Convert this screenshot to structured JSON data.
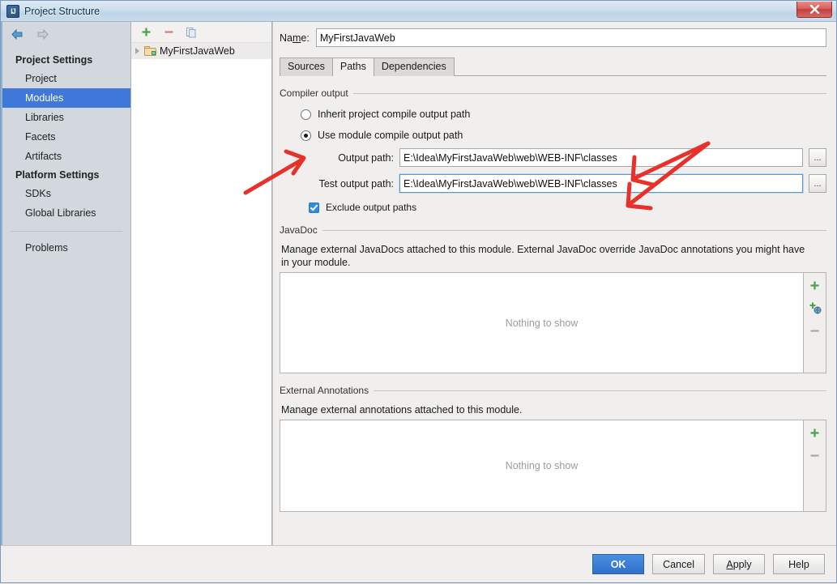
{
  "window": {
    "title": "Project Structure",
    "app_icon": "intellij-idea-icon",
    "close_label": "x"
  },
  "nav": {
    "back_icon": "arrow-left-icon",
    "forward_icon": "arrow-right-icon"
  },
  "sidebar": {
    "groups": [
      {
        "title": "Project Settings",
        "items": [
          {
            "label": "Project",
            "selected": false
          },
          {
            "label": "Modules",
            "selected": true
          },
          {
            "label": "Libraries",
            "selected": false
          },
          {
            "label": "Facets",
            "selected": false
          },
          {
            "label": "Artifacts",
            "selected": false
          }
        ]
      },
      {
        "title": "Platform Settings",
        "items": [
          {
            "label": "SDKs",
            "selected": false
          },
          {
            "label": "Global Libraries",
            "selected": false
          }
        ]
      }
    ],
    "footer_items": [
      {
        "label": "Problems",
        "selected": false
      }
    ],
    "selected_color": "#3f78d8",
    "background": "#d2d8de"
  },
  "tree": {
    "toolbar": [
      {
        "icon": "plus-icon",
        "name": "add-module-button"
      },
      {
        "icon": "minus-icon",
        "name": "remove-module-button"
      },
      {
        "icon": "copy-icon",
        "name": "copy-module-button"
      }
    ],
    "rows": [
      {
        "label": "MyFirstJavaWeb",
        "icon": "module-folder-icon",
        "expander": "collapsed"
      }
    ]
  },
  "main": {
    "name_label": "Name:",
    "name_label_pre": "Na",
    "name_label_mnemonic": "m",
    "name_label_post": "e:",
    "name_value": "MyFirstJavaWeb",
    "tabs": [
      {
        "label": "Sources",
        "active": false
      },
      {
        "label": "Paths",
        "active": true
      },
      {
        "label": "Dependencies",
        "active": false
      }
    ],
    "compiler_output": {
      "group_title": "Compiler output",
      "options": [
        {
          "label": "Inherit project compile output path",
          "checked": false
        },
        {
          "label": "Use module compile output path",
          "checked": true
        }
      ],
      "fields": [
        {
          "label": "Output path:",
          "value": "E:\\Idea\\MyFirstJavaWeb\\web\\WEB-INF\\classes",
          "focused": false,
          "browse_label": "..."
        },
        {
          "label": "Test output path:",
          "value": "E:\\Idea\\MyFirstJavaWeb\\web\\WEB-INF\\classes",
          "focused": true,
          "browse_label": "..."
        }
      ],
      "exclude_checkbox": {
        "label": "Exclude output paths",
        "checked": true
      }
    },
    "javadoc": {
      "group_title": "JavaDoc",
      "description": "Manage external JavaDocs attached to this module. External JavaDoc override JavaDoc annotations you might have in your module.",
      "empty_text": "Nothing to show",
      "buttons": [
        {
          "icon": "plus-icon",
          "name": "add-javadoc-button"
        },
        {
          "icon": "plus-globe-icon",
          "name": "add-javadoc-url-button"
        },
        {
          "icon": "minus-icon",
          "name": "remove-javadoc-button"
        }
      ]
    },
    "external_annotations": {
      "group_title": "External Annotations",
      "description": "Manage external annotations attached to this module.",
      "empty_text": "Nothing to show",
      "buttons": [
        {
          "icon": "plus-icon",
          "name": "add-annotation-button"
        },
        {
          "icon": "minus-icon",
          "name": "remove-annotation-button"
        }
      ]
    }
  },
  "footer": {
    "buttons": [
      {
        "label": "OK",
        "primary": true,
        "name": "ok-button"
      },
      {
        "label": "Cancel",
        "primary": false,
        "name": "cancel-button"
      },
      {
        "label": "Apply",
        "primary": false,
        "name": "apply-button",
        "mnemonic": "A"
      },
      {
        "label": "Help",
        "primary": false,
        "name": "help-button"
      }
    ]
  },
  "annotations": {
    "color": "#e8312a",
    "marks": [
      {
        "name": "arrow-to-use-module-radio",
        "description": "red arrow pointing up-right toward the 'Use module compile output path' radio button"
      },
      {
        "name": "arrow-to-output-path",
        "description": "red arrow pointing down-left toward the Output path field"
      },
      {
        "name": "arrow-to-test-output-path",
        "description": "red arrow pointing down-left toward the Test output path field"
      }
    ]
  }
}
